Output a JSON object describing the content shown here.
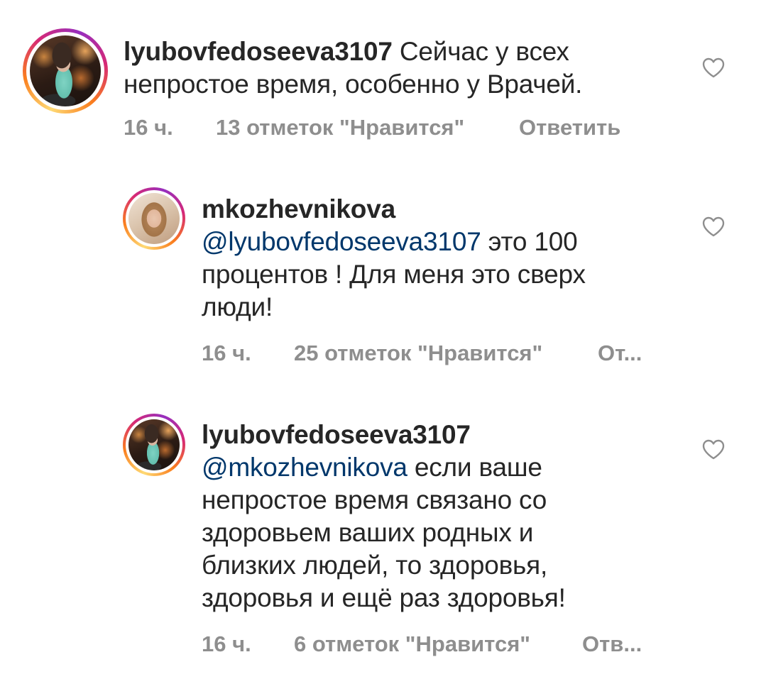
{
  "comments": [
    {
      "username": "lyubovfedoseeva3107",
      "mention": "",
      "text_lines": [
        "Сейчас у всех",
        "непростое время, особенно у Врачей."
      ],
      "time": "16 ч.",
      "likes": "13 отметок \"Нравится\"",
      "reply": "Ответить"
    },
    {
      "username": "mkozhevnikova",
      "mention": "@lyubovfedoseeva3107",
      "text_lines": [
        " это 100",
        "процентов ! Для меня это сверх",
        "люди!"
      ],
      "time": "16 ч.",
      "likes": "25 отметок \"Нравится\"",
      "reply": "От..."
    },
    {
      "username": "lyubovfedoseeva3107",
      "mention": "@mkozhevnikova",
      "text_lines": [
        " если ваше",
        "непростое время связано со",
        "здоровьем ваших родных и",
        "близких людей, то здоровья,",
        "здоровья и ещё раз здоровья!"
      ],
      "time": "16 ч.",
      "likes": "6 отметок \"Нравится\"",
      "reply": "Отв..."
    }
  ],
  "icons": {
    "like": "heart-outline-icon"
  },
  "colors": {
    "text": "#262626",
    "meta": "#8e8e8e",
    "mention": "#00376b"
  }
}
